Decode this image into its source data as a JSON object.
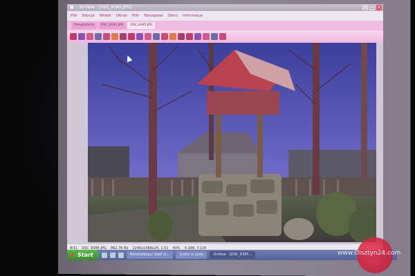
{
  "window": {
    "title": "XnView - [DSC_8385.JPG]",
    "app_icon": "xnview-icon",
    "minimize": "_",
    "maximize": "□",
    "close": "×"
  },
  "menu": [
    "Plik",
    "Edycja",
    "Widok",
    "Obraz",
    "Filtr",
    "Narzędzia",
    "Okno",
    "Informacje"
  ],
  "tabs": [
    {
      "label": "Przeglądarka",
      "active": false
    },
    {
      "label": "DSC_8381.JPG",
      "active": false
    },
    {
      "label": "DSC_8385.JPG",
      "active": true
    }
  ],
  "toolbar_icons": [
    "back-icon",
    "forward-icon",
    "open-icon",
    "save-icon",
    "print-icon",
    "copy-icon",
    "paste-icon",
    "rotate-left-icon",
    "rotate-right-icon",
    "crop-icon",
    "resize-icon",
    "zoom-in-icon",
    "zoom-out-icon",
    "fit-icon",
    "fullscreen-icon",
    "slideshow-icon",
    "info-icon",
    "settings-icon",
    "help-icon"
  ],
  "status": {
    "index": "8/11",
    "filename": "DSC_8385.JPG",
    "filesize": "862.76 Kb",
    "dimensions": "2240x1488x24, 1.51",
    "zoom": "40%",
    "coords": "X:288, Y:124"
  },
  "taskbar": {
    "start_label": "Start",
    "buttons": [
      {
        "label": "Niedziałający slajd ro...",
        "active": false
      },
      {
        "label": "Groby w Lesie",
        "active": false
      },
      {
        "label": "XnView - [DSC_8385...",
        "active": true
      }
    ]
  },
  "watermark": "www.Olsztyn24.com",
  "colors": {
    "accent": "#e55a76",
    "tab_bar": "#f0bbe0",
    "taskbar": "#5a6aa4",
    "start": "#4aa33c"
  }
}
